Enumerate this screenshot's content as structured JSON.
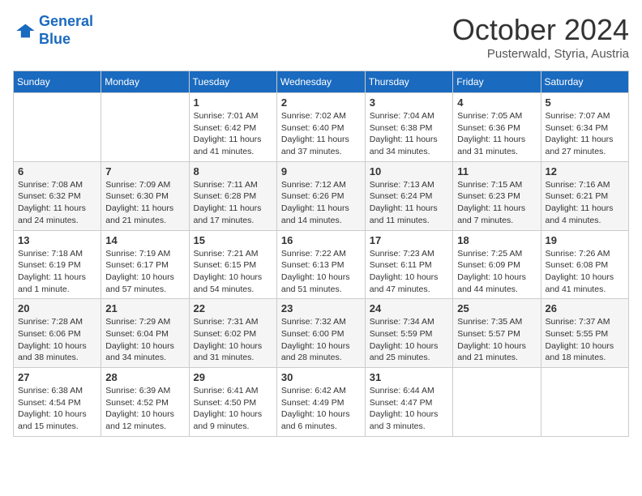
{
  "logo": {
    "line1": "General",
    "line2": "Blue"
  },
  "title": "October 2024",
  "location": "Pusterwald, Styria, Austria",
  "weekdays": [
    "Sunday",
    "Monday",
    "Tuesday",
    "Wednesday",
    "Thursday",
    "Friday",
    "Saturday"
  ],
  "weeks": [
    [
      null,
      null,
      {
        "day": 1,
        "sunrise": "7:01 AM",
        "sunset": "6:42 PM",
        "daylight": "11 hours and 41 minutes."
      },
      {
        "day": 2,
        "sunrise": "7:02 AM",
        "sunset": "6:40 PM",
        "daylight": "11 hours and 37 minutes."
      },
      {
        "day": 3,
        "sunrise": "7:04 AM",
        "sunset": "6:38 PM",
        "daylight": "11 hours and 34 minutes."
      },
      {
        "day": 4,
        "sunrise": "7:05 AM",
        "sunset": "6:36 PM",
        "daylight": "11 hours and 31 minutes."
      },
      {
        "day": 5,
        "sunrise": "7:07 AM",
        "sunset": "6:34 PM",
        "daylight": "11 hours and 27 minutes."
      }
    ],
    [
      {
        "day": 6,
        "sunrise": "7:08 AM",
        "sunset": "6:32 PM",
        "daylight": "11 hours and 24 minutes."
      },
      {
        "day": 7,
        "sunrise": "7:09 AM",
        "sunset": "6:30 PM",
        "daylight": "11 hours and 21 minutes."
      },
      {
        "day": 8,
        "sunrise": "7:11 AM",
        "sunset": "6:28 PM",
        "daylight": "11 hours and 17 minutes."
      },
      {
        "day": 9,
        "sunrise": "7:12 AM",
        "sunset": "6:26 PM",
        "daylight": "11 hours and 14 minutes."
      },
      {
        "day": 10,
        "sunrise": "7:13 AM",
        "sunset": "6:24 PM",
        "daylight": "11 hours and 11 minutes."
      },
      {
        "day": 11,
        "sunrise": "7:15 AM",
        "sunset": "6:23 PM",
        "daylight": "11 hours and 7 minutes."
      },
      {
        "day": 12,
        "sunrise": "7:16 AM",
        "sunset": "6:21 PM",
        "daylight": "11 hours and 4 minutes."
      }
    ],
    [
      {
        "day": 13,
        "sunrise": "7:18 AM",
        "sunset": "6:19 PM",
        "daylight": "11 hours and 1 minute."
      },
      {
        "day": 14,
        "sunrise": "7:19 AM",
        "sunset": "6:17 PM",
        "daylight": "10 hours and 57 minutes."
      },
      {
        "day": 15,
        "sunrise": "7:21 AM",
        "sunset": "6:15 PM",
        "daylight": "10 hours and 54 minutes."
      },
      {
        "day": 16,
        "sunrise": "7:22 AM",
        "sunset": "6:13 PM",
        "daylight": "10 hours and 51 minutes."
      },
      {
        "day": 17,
        "sunrise": "7:23 AM",
        "sunset": "6:11 PM",
        "daylight": "10 hours and 47 minutes."
      },
      {
        "day": 18,
        "sunrise": "7:25 AM",
        "sunset": "6:09 PM",
        "daylight": "10 hours and 44 minutes."
      },
      {
        "day": 19,
        "sunrise": "7:26 AM",
        "sunset": "6:08 PM",
        "daylight": "10 hours and 41 minutes."
      }
    ],
    [
      {
        "day": 20,
        "sunrise": "7:28 AM",
        "sunset": "6:06 PM",
        "daylight": "10 hours and 38 minutes."
      },
      {
        "day": 21,
        "sunrise": "7:29 AM",
        "sunset": "6:04 PM",
        "daylight": "10 hours and 34 minutes."
      },
      {
        "day": 22,
        "sunrise": "7:31 AM",
        "sunset": "6:02 PM",
        "daylight": "10 hours and 31 minutes."
      },
      {
        "day": 23,
        "sunrise": "7:32 AM",
        "sunset": "6:00 PM",
        "daylight": "10 hours and 28 minutes."
      },
      {
        "day": 24,
        "sunrise": "7:34 AM",
        "sunset": "5:59 PM",
        "daylight": "10 hours and 25 minutes."
      },
      {
        "day": 25,
        "sunrise": "7:35 AM",
        "sunset": "5:57 PM",
        "daylight": "10 hours and 21 minutes."
      },
      {
        "day": 26,
        "sunrise": "7:37 AM",
        "sunset": "5:55 PM",
        "daylight": "10 hours and 18 minutes."
      }
    ],
    [
      {
        "day": 27,
        "sunrise": "6:38 AM",
        "sunset": "4:54 PM",
        "daylight": "10 hours and 15 minutes."
      },
      {
        "day": 28,
        "sunrise": "6:39 AM",
        "sunset": "4:52 PM",
        "daylight": "10 hours and 12 minutes."
      },
      {
        "day": 29,
        "sunrise": "6:41 AM",
        "sunset": "4:50 PM",
        "daylight": "10 hours and 9 minutes."
      },
      {
        "day": 30,
        "sunrise": "6:42 AM",
        "sunset": "4:49 PM",
        "daylight": "10 hours and 6 minutes."
      },
      {
        "day": 31,
        "sunrise": "6:44 AM",
        "sunset": "4:47 PM",
        "daylight": "10 hours and 3 minutes."
      },
      null,
      null
    ]
  ]
}
